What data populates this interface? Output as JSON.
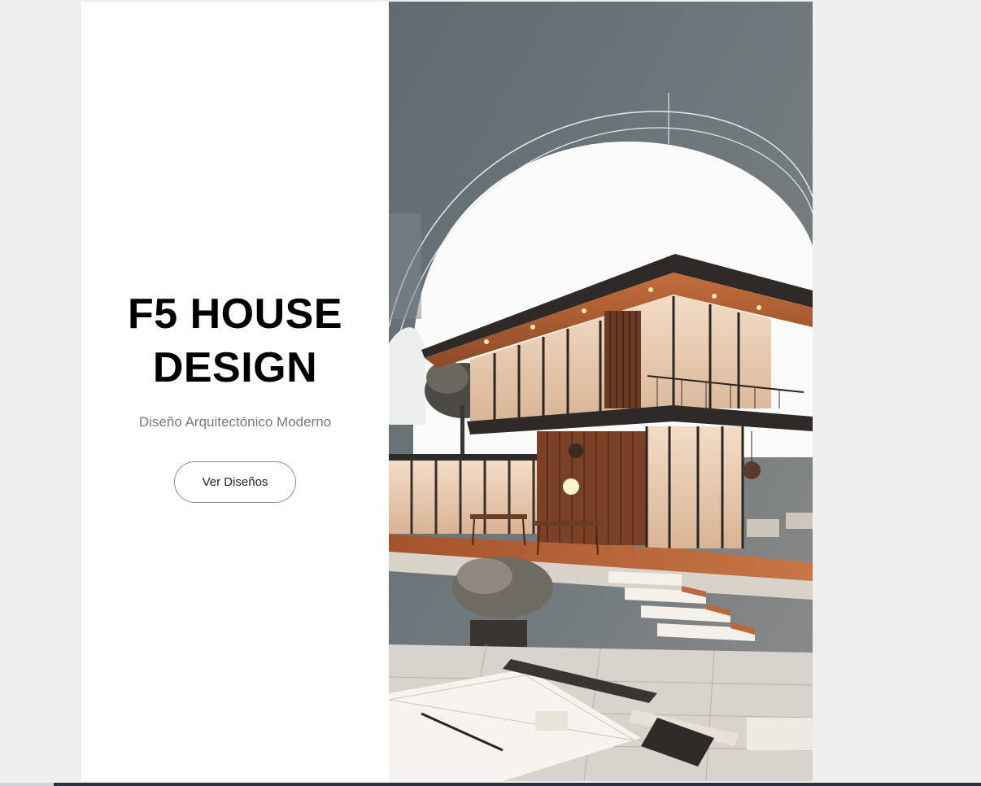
{
  "hero": {
    "title": "F5 HOUSE DESIGN",
    "subtitle": "Diseño Arquitectónico Moderno",
    "button_label": "Ver Diseños"
  },
  "image": {
    "icon": "modern-house-illustration"
  },
  "colors": {
    "page_background": "#efefef",
    "panel_background": "#ffffff",
    "title": "#000000",
    "subtitle": "#7a7a7a",
    "button_border": "#8a8a8a",
    "sky": "#6b7478",
    "wood": "#b5633a"
  }
}
